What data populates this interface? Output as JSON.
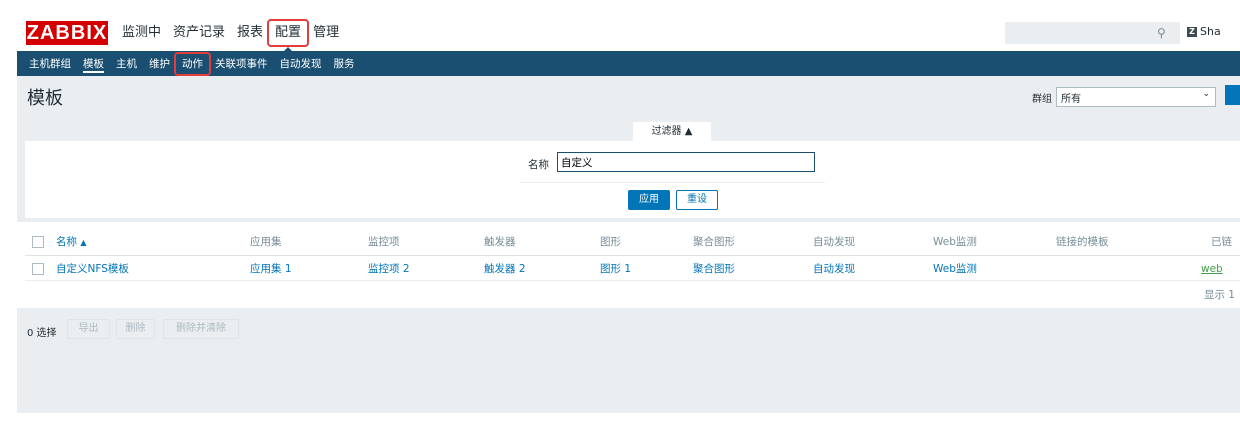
{
  "header": {
    "logo_text": "ZABBIX",
    "main_menu": [
      {
        "label": "监测中"
      },
      {
        "label": "资产记录"
      },
      {
        "label": "报表"
      },
      {
        "label": "配置",
        "active": true
      },
      {
        "label": "管理"
      }
    ],
    "search": {
      "value": "",
      "placeholder": ""
    },
    "share_label": "Sha"
  },
  "submenu": {
    "items": [
      {
        "label": "主机群组"
      },
      {
        "label": "模板",
        "selected": true
      },
      {
        "label": "主机"
      },
      {
        "label": "维护"
      },
      {
        "label": "动作",
        "highlighted": true
      },
      {
        "label": "关联项事件"
      },
      {
        "label": "自动发现"
      },
      {
        "label": "服务"
      }
    ]
  },
  "page": {
    "title": "模板",
    "group_label": "群组",
    "group_value": "所有"
  },
  "filter": {
    "tab_label": "过滤器 ▲",
    "name_label": "名称",
    "name_value": "自定义",
    "apply_label": "应用",
    "reset_label": "重设"
  },
  "table": {
    "headers": {
      "name": "名称",
      "applications": "应用集",
      "items": "监控项",
      "triggers": "触发器",
      "graphs": "图形",
      "screens": "聚合图形",
      "discovery": "自动发现",
      "web": "Web监测",
      "linked_templates": "链接的模板",
      "linked_to": "已链"
    },
    "rows": [
      {
        "name": "自定义NFS模板",
        "applications": "应用集 1",
        "items": "监控项 2",
        "triggers": "触发器 2",
        "graphs": "图形 1",
        "screens": "聚合图形",
        "discovery": "自动发现",
        "web": "Web监测",
        "linked_templates": "",
        "linked_to": "web"
      }
    ],
    "footer_text": "显示 1"
  },
  "actions": {
    "selected_count": "0 选择",
    "export_label": "导出",
    "delete_label": "删除",
    "delete_clear_label": "删除并清除"
  },
  "colors": {
    "brand": "#d40000",
    "nav_bg": "#1b4f72",
    "link": "#0275b8",
    "highlight": "#e23c3c"
  }
}
